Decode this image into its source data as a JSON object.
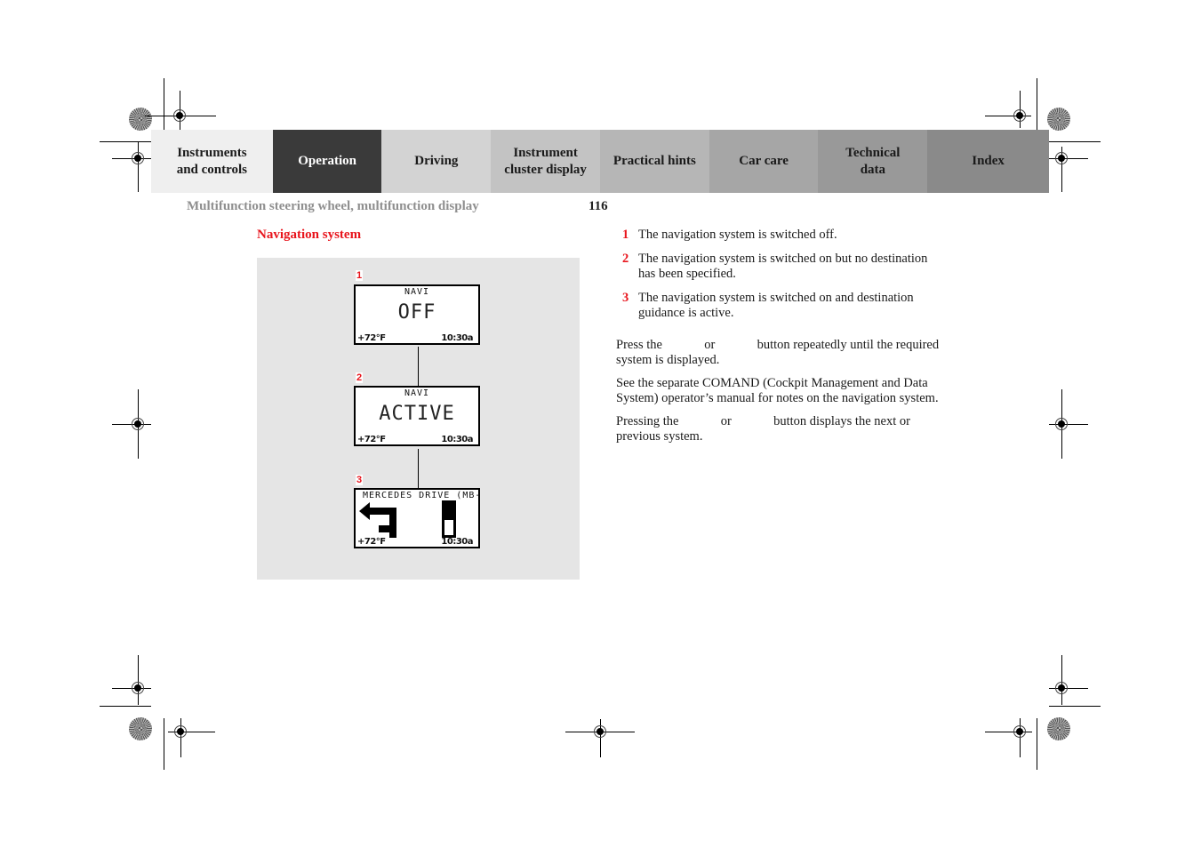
{
  "tabs": [
    {
      "label_line1": "Instruments",
      "label_line2": "and controls",
      "active": false
    },
    {
      "label_line1": "Operation",
      "label_line2": "",
      "active": true
    },
    {
      "label_line1": "Driving",
      "label_line2": "",
      "active": false
    },
    {
      "label_line1": "Instrument",
      "label_line2": "cluster display",
      "active": false
    },
    {
      "label_line1": "Practical hints",
      "label_line2": "",
      "active": false
    },
    {
      "label_line1": "Car care",
      "label_line2": "",
      "active": false
    },
    {
      "label_line1": "Technical",
      "label_line2": "data",
      "active": false
    },
    {
      "label_line1": "Index",
      "label_line2": "",
      "active": false
    }
  ],
  "header": {
    "section_title": "Multifunction steering wheel, multifunction display",
    "page_number": "116"
  },
  "content": {
    "heading": "Navigation system",
    "accent_color": "#e8141c",
    "displays": [
      {
        "label": "1",
        "top": "NAVI",
        "main": "OFF",
        "temp": "+72°F",
        "time": "10:30a"
      },
      {
        "label": "2",
        "top": "NAVI",
        "main": "ACTIVE",
        "temp": "+72°F",
        "time": "10:30a"
      },
      {
        "label": "3",
        "top": "MERCEDES DRIVE (MB-",
        "main": "",
        "temp": "+72°F",
        "time": "10:30a",
        "icons": [
          "turn-left-arrow-icon",
          "distance-bar-icon"
        ]
      }
    ],
    "legend": [
      {
        "num": "1",
        "text": "The navigation system is switched off."
      },
      {
        "num": "2",
        "text": "The navigation system is switched on but no destination has been specified."
      },
      {
        "num": "3",
        "text": "The navigation system is switched on and destination guidance is active."
      }
    ],
    "paragraphs": {
      "p1_a": "Press the",
      "p1_or": "or",
      "p1_b": "button repeatedly until the required system is displayed.",
      "p2": "See the separate COMAND (Cockpit Management and Data System) operator’s manual for notes on the navigation system.",
      "p3_a": "Pressing the",
      "p3_or": "or",
      "p3_b": "button displays the next or previous system."
    }
  }
}
